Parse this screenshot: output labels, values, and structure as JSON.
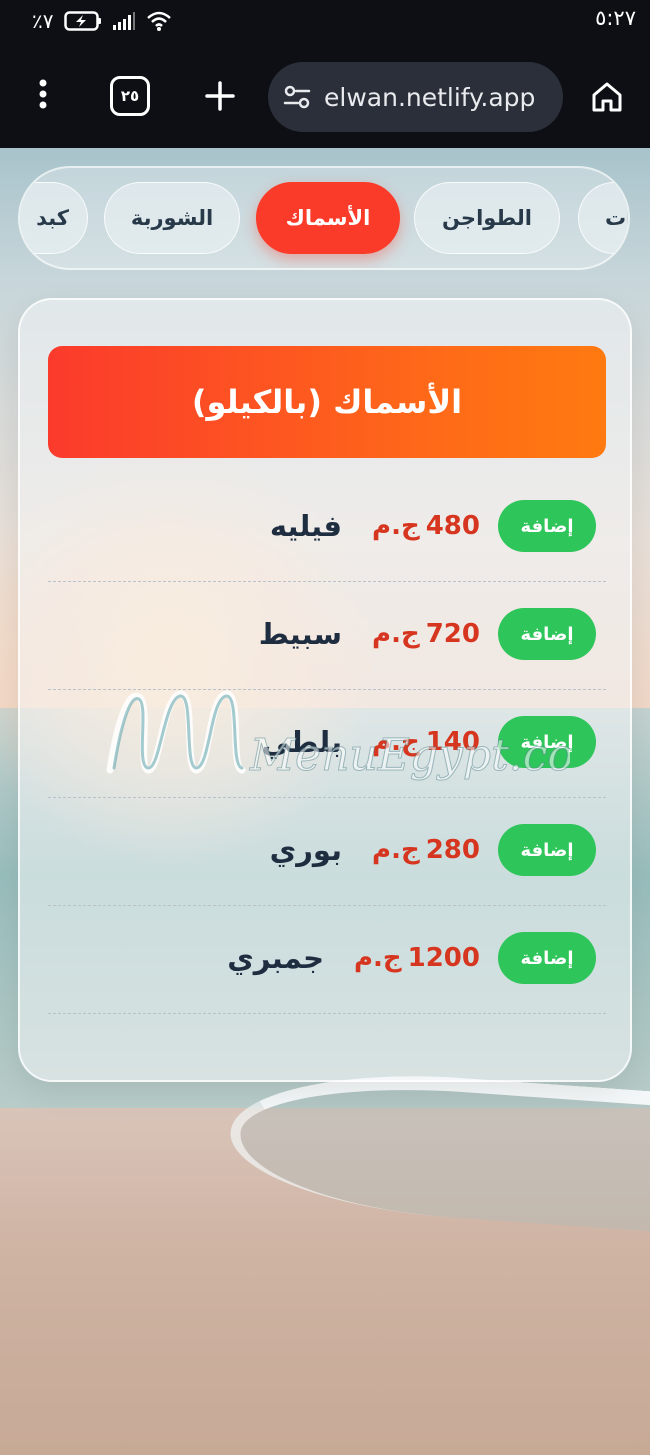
{
  "status_bar": {
    "battery_percent": "٪٧",
    "time": "٥:٢٧"
  },
  "browser": {
    "tab_count": "٢٥",
    "url": "elwan.netlify.app",
    "icons": [
      "menu-dots-icon",
      "tabs-icon",
      "plus-icon",
      "tune-icon",
      "home-icon"
    ]
  },
  "categories": [
    {
      "label": "ات",
      "active": false
    },
    {
      "label": "الطواجن",
      "active": false
    },
    {
      "label": "الأسماك",
      "active": true
    },
    {
      "label": "الشوربة",
      "active": false
    },
    {
      "label": "كبد",
      "active": false
    }
  ],
  "menu": {
    "section_title": "الأسماك (بالكيلو)",
    "add_label": "إضافة",
    "currency": "ج.م",
    "items": [
      {
        "name": "فيليه",
        "price": "480"
      },
      {
        "name": "سبيط",
        "price": "720"
      },
      {
        "name": "بلطي",
        "price": "140"
      },
      {
        "name": "بوري",
        "price": "280"
      },
      {
        "name": "جمبري",
        "price": "1200"
      }
    ]
  },
  "watermark": {
    "text": "MenuEgypt.com"
  },
  "colors": {
    "accent_red": "#fb3b2a",
    "accent_orange": "#ff7a10",
    "add_green": "#2ec55a",
    "price_red": "#d6361f",
    "text_dark": "#1e2d40"
  }
}
